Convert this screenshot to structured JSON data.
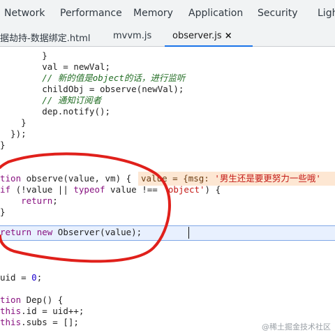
{
  "panel_tabs": [
    "Network",
    "Performance",
    "Memory",
    "Application",
    "Security",
    "Ligh"
  ],
  "file_tabs": [
    {
      "label": "据劫持-数据绑定.html"
    },
    {
      "label": "mvvm.js"
    },
    {
      "label": "observer.js",
      "close": "×"
    }
  ],
  "code": {
    "l1": "        }",
    "l2_a": "        val = newVal;",
    "l3": "        // 新的值是object的话，进行监听",
    "l4": "        childObj = observe(newVal);",
    "l5": "        // 通知订阅者",
    "l6": "        dep.notify();",
    "l7": "    }",
    "l8": "  });",
    "l9": "}",
    "l10_kw": "tion",
    "l10_rest": " observe(value, vm) {",
    "inline_value_prefix": "value = {msg: ",
    "inline_value_str": "'男生还是要更努力一些哦'",
    "l11_kw": "if",
    "l11_a": " (!value || ",
    "l11_typeof": "typeof",
    "l11_b": " value !== ",
    "l11_str": "'object'",
    "l11_c": ") {",
    "l12_kw": "return",
    "l12_rest": ";",
    "l13": "}",
    "l14_kw": "return",
    "l14_new": "new",
    "l14_rest": " Observer(value);",
    "l15_a": "uid = ",
    "l15_num": "0",
    "l15_b": ";",
    "l16_kw": "tion",
    "l16_rest": " Dep() {",
    "l17_this": "this",
    "l17_rest": ".id = uid++;",
    "l18_this": "this",
    "l18_rest": ".subs = [];"
  },
  "watermark": "@稀土掘金技术社区",
  "colors": {
    "annotation_circle": "#e0201b",
    "highlight_line": "#e8f0fe",
    "inline_value_bg": "#fde7d3",
    "active_tab_underline": "#1a73e8"
  }
}
